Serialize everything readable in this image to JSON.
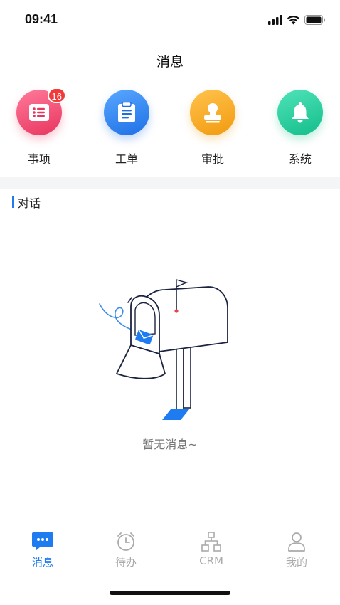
{
  "status_bar": {
    "time": "09:41"
  },
  "header": {
    "title": "消息"
  },
  "quick_actions": [
    {
      "label": "事项",
      "badge": "16",
      "icon": "list-icon",
      "color": "#f04a7c"
    },
    {
      "label": "工单",
      "badge": "",
      "icon": "clipboard-icon",
      "color": "#1e7bf0"
    },
    {
      "label": "审批",
      "badge": "",
      "icon": "stamp-icon",
      "color": "#f7a516"
    },
    {
      "label": "系统",
      "badge": "",
      "icon": "bell-icon",
      "color": "#1fcf9b"
    }
  ],
  "section": {
    "title": "对话"
  },
  "empty_state": {
    "text": "暂无消息~",
    "icon": "mailbox-illustration"
  },
  "tab_bar": [
    {
      "label": "消息",
      "icon": "chat-icon",
      "active": true
    },
    {
      "label": "待办",
      "icon": "clock-icon",
      "active": false
    },
    {
      "label": "CRM",
      "icon": "org-chart-icon",
      "active": false
    },
    {
      "label": "我的",
      "icon": "person-icon",
      "active": false
    }
  ],
  "colors": {
    "accent": "#1e7bf0",
    "badge": "#f23a3a"
  }
}
